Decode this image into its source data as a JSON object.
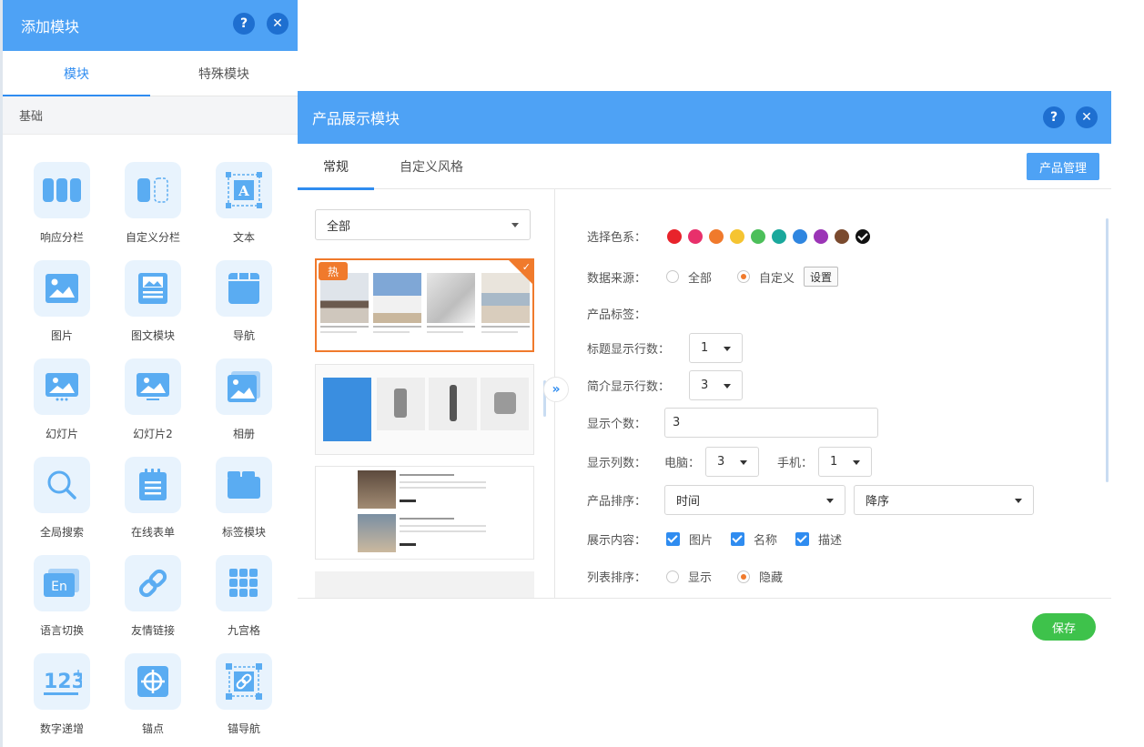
{
  "left_panel": {
    "title": "添加模块",
    "tabs": [
      {
        "label": "模块",
        "active": true
      },
      {
        "label": "特殊模块",
        "active": false
      }
    ],
    "group_label": "基础",
    "modules": [
      {
        "label": "响应分栏",
        "icon": "columns-icon"
      },
      {
        "label": "自定义分栏",
        "icon": "custom-columns-icon"
      },
      {
        "label": "文本",
        "icon": "text-icon"
      },
      {
        "label": "图片",
        "icon": "image-icon"
      },
      {
        "label": "图文模块",
        "icon": "image-text-icon"
      },
      {
        "label": "导航",
        "icon": "navigation-icon"
      },
      {
        "label": "幻灯片",
        "icon": "slideshow-icon"
      },
      {
        "label": "幻灯片2",
        "icon": "slideshow2-icon"
      },
      {
        "label": "相册",
        "icon": "album-icon"
      },
      {
        "label": "全局搜索",
        "icon": "search-icon"
      },
      {
        "label": "在线表单",
        "icon": "form-icon"
      },
      {
        "label": "标签模块",
        "icon": "tabs-icon"
      },
      {
        "label": "语言切换",
        "icon": "language-icon"
      },
      {
        "label": "友情链接",
        "icon": "link-icon"
      },
      {
        "label": "九宫格",
        "icon": "grid-icon"
      },
      {
        "label": "数字递增",
        "icon": "counter-icon"
      },
      {
        "label": "锚点",
        "icon": "anchor-icon"
      },
      {
        "label": "锚导航",
        "icon": "anchor-nav-icon"
      }
    ]
  },
  "dialog": {
    "title": "产品展示模块",
    "tabs": [
      {
        "label": "常规",
        "active": true
      },
      {
        "label": "自定义风格",
        "active": false
      }
    ],
    "manage_button": "产品管理",
    "category_select": "全部",
    "hot_badge": "热",
    "settings": {
      "color_label": "选择色系：",
      "colors": [
        "#e8232b",
        "#e8306b",
        "#f07a2c",
        "#f5c431",
        "#4cbf5a",
        "#1aa89c",
        "#2f86e0",
        "#9b35b6",
        "#7a4a2e",
        "#111111"
      ],
      "selected_color_index": 9,
      "source_label": "数据来源：",
      "source_options": [
        "全部",
        "自定义"
      ],
      "source_selected": "自定义",
      "source_settings_button": "设置",
      "tag_label": "产品标签：",
      "title_lines_label": "标题显示行数：",
      "title_lines_value": "1",
      "intro_lines_label": "简介显示行数：",
      "intro_lines_value": "3",
      "count_label": "显示个数：",
      "count_value": "3",
      "columns_label": "显示列数：",
      "pc_label": "电脑：",
      "pc_value": "3",
      "mobile_label": "手机：",
      "mobile_value": "1",
      "sort_label": "产品排序：",
      "sort_field": "时间",
      "sort_order": "降序",
      "content_label": "展示内容：",
      "content_options": [
        "图片",
        "名称",
        "描述"
      ],
      "list_sort_label": "列表排序：",
      "list_sort_options": [
        "显示",
        "隐藏"
      ],
      "list_sort_selected": "隐藏"
    },
    "save_button": "保存"
  }
}
